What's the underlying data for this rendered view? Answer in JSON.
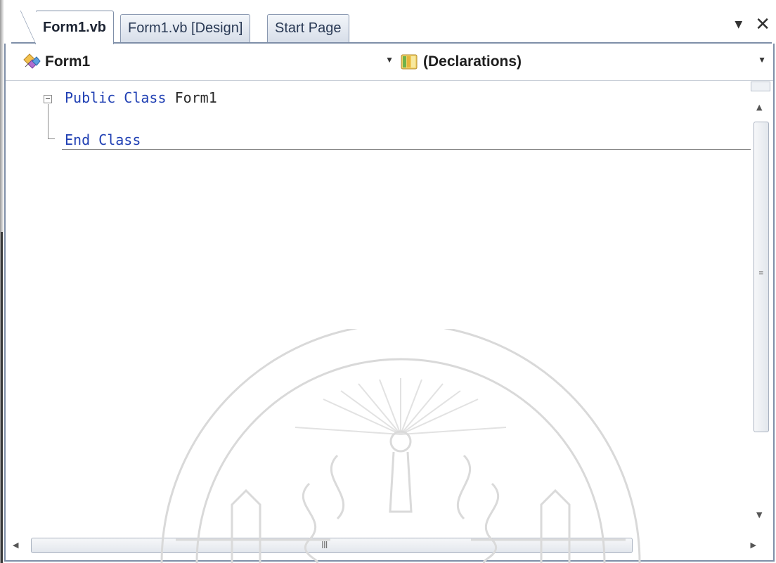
{
  "tabs": [
    {
      "label": "Form1.vb",
      "active": true
    },
    {
      "label": "Form1.vb [Design]",
      "active": false
    },
    {
      "label": "Start Page",
      "active": false
    }
  ],
  "tab_controls": {
    "dropdown_icon": "dropdown-arrow-icon",
    "close_icon": "close-icon"
  },
  "navbar": {
    "class_combo": {
      "value": "Form1",
      "icon": "class-icon"
    },
    "member_combo": {
      "value": "(Declarations)",
      "icon": "declarations-icon"
    }
  },
  "code": {
    "line1": {
      "kw1": "Public",
      "kw2": "Class",
      "name": "Form1"
    },
    "line2": {
      "kw1": "End",
      "kw2": "Class"
    }
  },
  "scrollbars": {
    "vertical_grip": "≡",
    "horizontal_grip": "III"
  },
  "colors": {
    "keyword": "#1f3fb3",
    "tab_border": "#7f8fa8"
  }
}
